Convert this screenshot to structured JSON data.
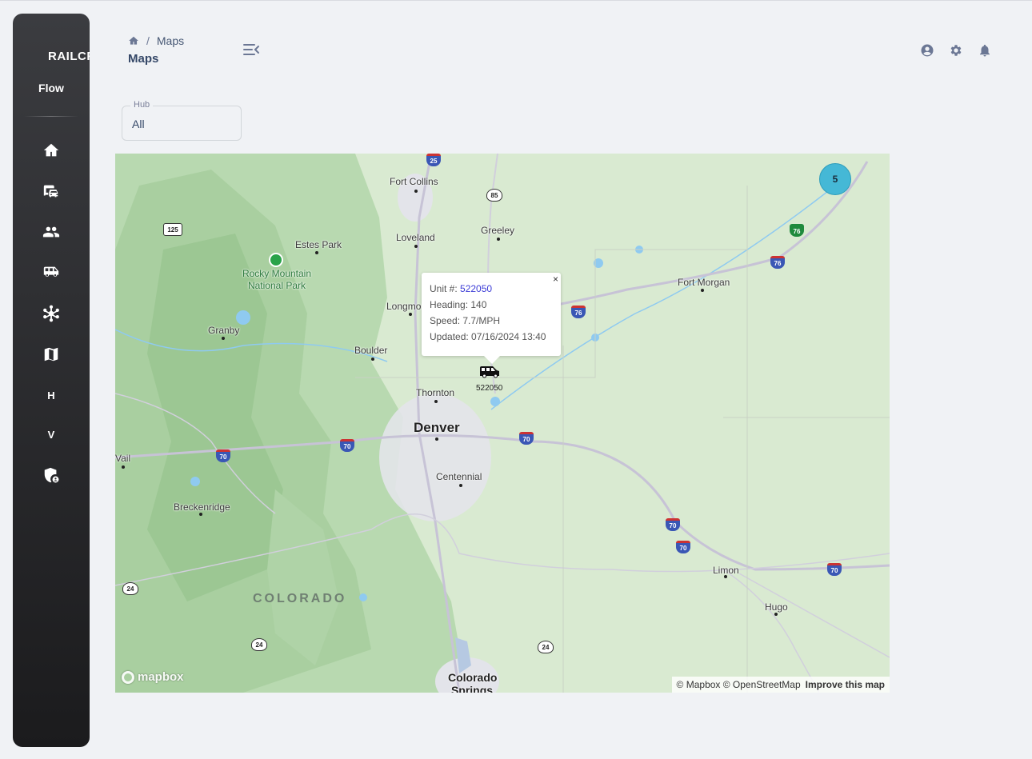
{
  "sidebar": {
    "brand": "RAILCREW",
    "brand_sub": "Flow",
    "items": [
      {
        "icon": "home-icon",
        "label": ""
      },
      {
        "icon": "car-bus-icon",
        "label": ""
      },
      {
        "icon": "people-icon",
        "label": ""
      },
      {
        "icon": "van-icon",
        "label": ""
      },
      {
        "icon": "network-icon",
        "label": ""
      },
      {
        "icon": "map-icon",
        "label": ""
      },
      {
        "icon": "letter",
        "label": "H"
      },
      {
        "icon": "letter",
        "label": "V"
      },
      {
        "icon": "shield-user-icon",
        "label": ""
      }
    ]
  },
  "header": {
    "breadcrumb_current": "Maps",
    "title": "Maps"
  },
  "filter": {
    "hub_label": "Hub",
    "hub_value": "All"
  },
  "map": {
    "cities": {
      "fort_collins": "Fort Collins",
      "loveland": "Loveland",
      "greeley": "Greeley",
      "estes_park": "Estes Park",
      "fort_morgan": "Fort Morgan",
      "longmont": "Longmont",
      "granby": "Granby",
      "boulder": "Boulder",
      "thornton": "Thornton",
      "denver": "Denver",
      "vail": "Vail",
      "centennial": "Centennial",
      "breckenridge": "Breckenridge",
      "limon": "Limon",
      "hugo": "Hugo",
      "colorado_springs": "Colorado Springs"
    },
    "park": "Rocky Mountain National Park",
    "state": "COLORADO",
    "shields": {
      "i25": "25",
      "us85": "85",
      "us125": "125",
      "i76": "76",
      "i70": "70",
      "us24": "24"
    },
    "cluster_count": "5",
    "popup": {
      "unit_label": "Unit #:",
      "unit_value": "522050",
      "heading": "Heading: 140",
      "speed": "Speed: 7.7/MPH",
      "updated": "Updated: 07/16/2024 13:40",
      "close": "×"
    },
    "vehicle_label": "522050",
    "logo": "mapbox",
    "attribution": "© Mapbox © OpenStreetMap",
    "improve": "Improve this map"
  }
}
